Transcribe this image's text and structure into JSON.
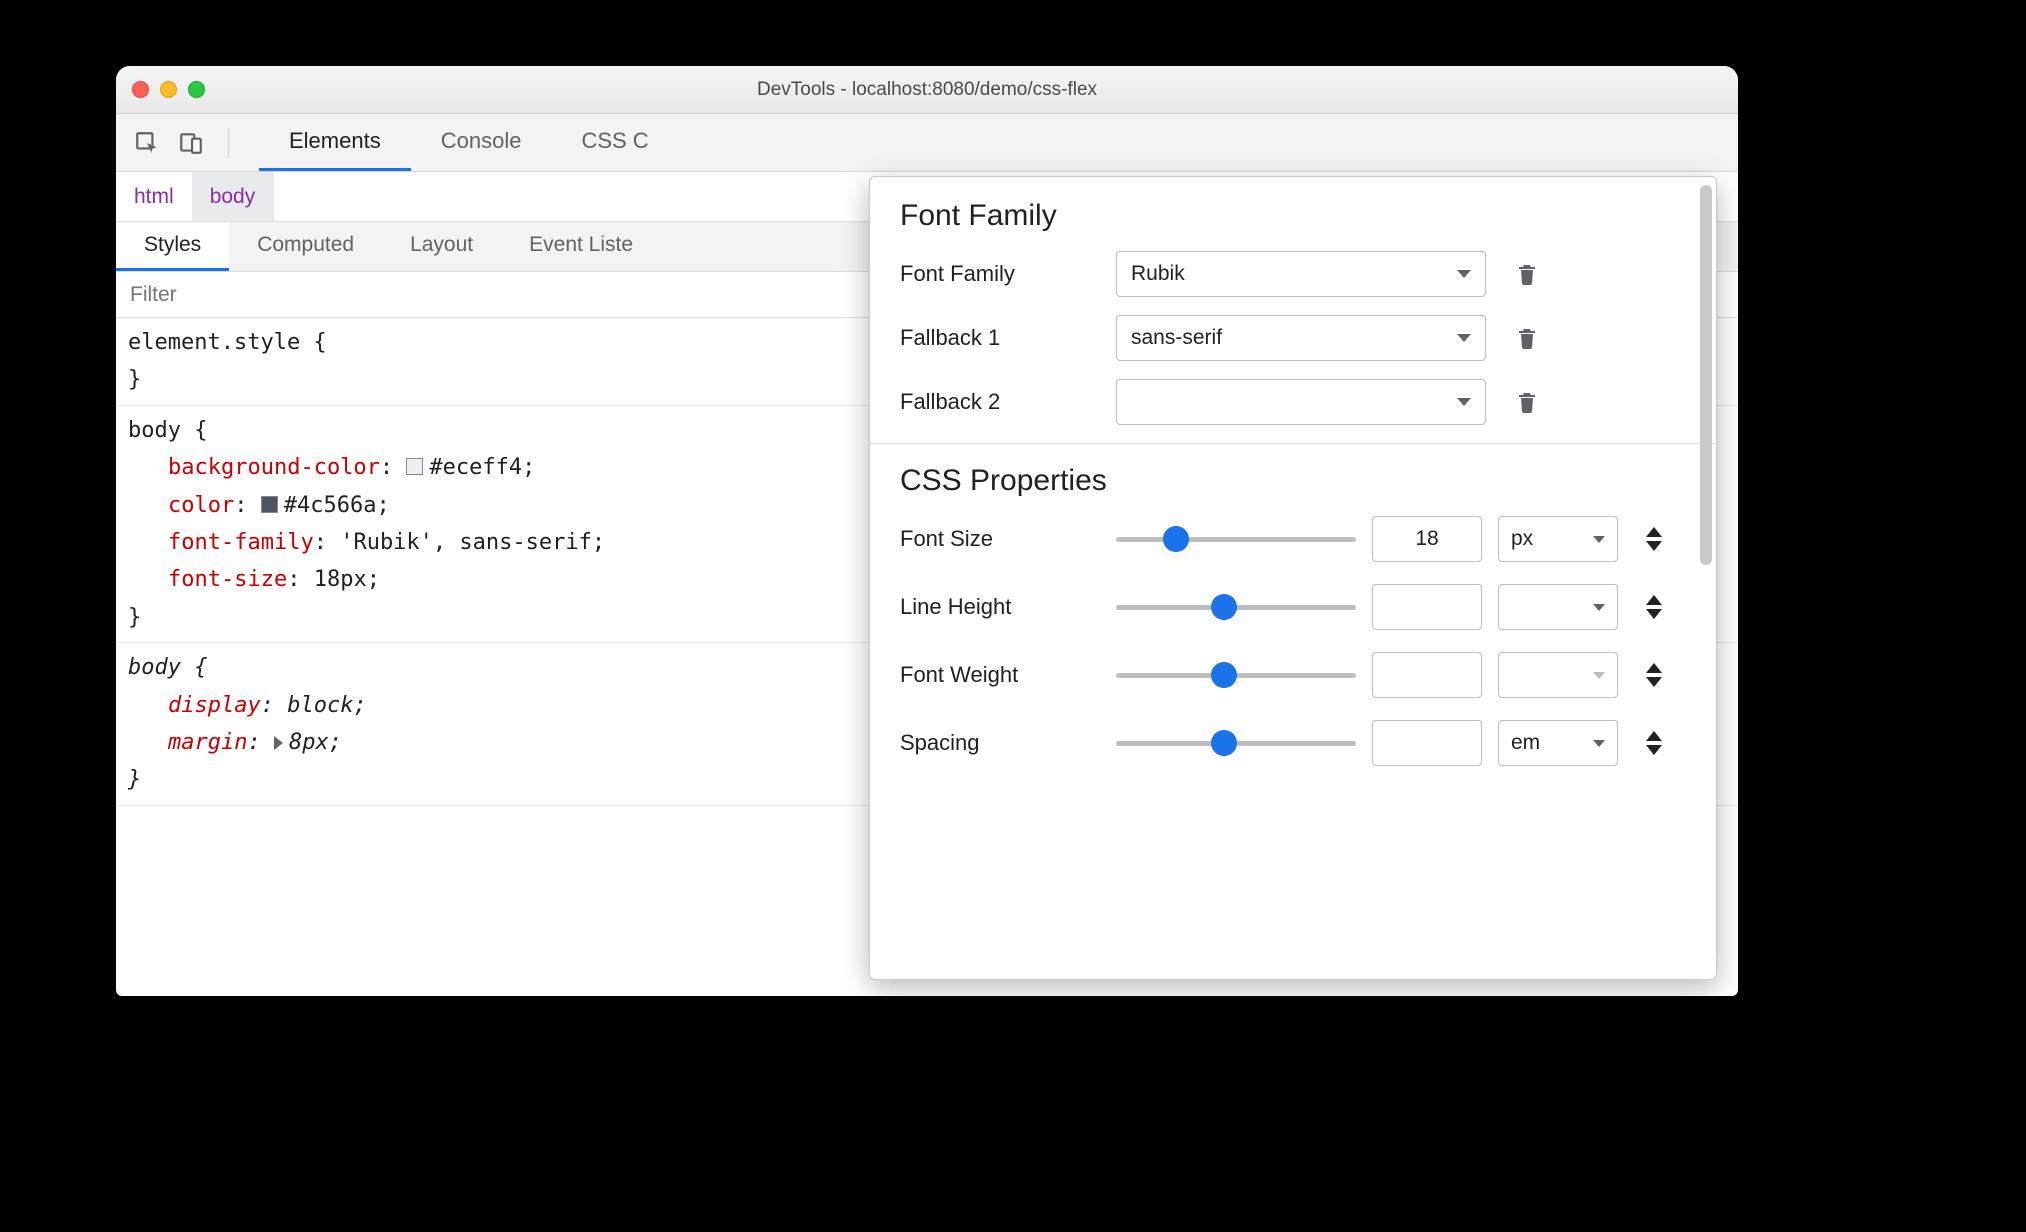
{
  "window": {
    "title": "DevTools - localhost:8080/demo/css-flex"
  },
  "toolbar": {
    "tabs": [
      "Elements",
      "Console",
      "CSS C"
    ],
    "active_index": 0
  },
  "breadcrumbs": {
    "items": [
      "html",
      "body"
    ],
    "selected_index": 1
  },
  "subtabs": {
    "items": [
      "Styles",
      "Computed",
      "Layout",
      "Event Liste"
    ],
    "active_index": 0
  },
  "filter": {
    "placeholder": "Filter"
  },
  "styles": {
    "rules": [
      {
        "selector": "element.style",
        "italic": false,
        "declarations": []
      },
      {
        "selector": "body",
        "italic": false,
        "declarations": [
          {
            "prop": "background-color",
            "swatch": "#eceff4",
            "value": "#eceff4"
          },
          {
            "prop": "color",
            "swatch": "#4c566a",
            "value": "#4c566a"
          },
          {
            "prop": "font-family",
            "value": "'Rubik', sans-serif"
          },
          {
            "prop": "font-size",
            "value": "18px"
          }
        ]
      },
      {
        "selector": "body",
        "italic": true,
        "declarations": [
          {
            "prop": "display",
            "value": "block"
          },
          {
            "prop": "margin",
            "expand": true,
            "value": "8px"
          }
        ]
      }
    ]
  },
  "popover": {
    "section_font_family": {
      "heading": "Font Family",
      "rows": [
        {
          "label": "Font Family",
          "value": "Rubik"
        },
        {
          "label": "Fallback 1",
          "value": "sans-serif"
        },
        {
          "label": "Fallback 2",
          "value": ""
        }
      ]
    },
    "section_css_properties": {
      "heading": "CSS Properties",
      "rows": [
        {
          "label": "Font Size",
          "slider_pct": 25,
          "value": "18",
          "unit": "px",
          "unit_disabled": false
        },
        {
          "label": "Line Height",
          "slider_pct": 45,
          "value": "",
          "unit": "",
          "unit_disabled": false
        },
        {
          "label": "Font Weight",
          "slider_pct": 45,
          "value": "",
          "unit": "",
          "unit_disabled": true
        },
        {
          "label": "Spacing",
          "slider_pct": 45,
          "value": "",
          "unit": "em",
          "unit_disabled": false
        }
      ]
    }
  }
}
